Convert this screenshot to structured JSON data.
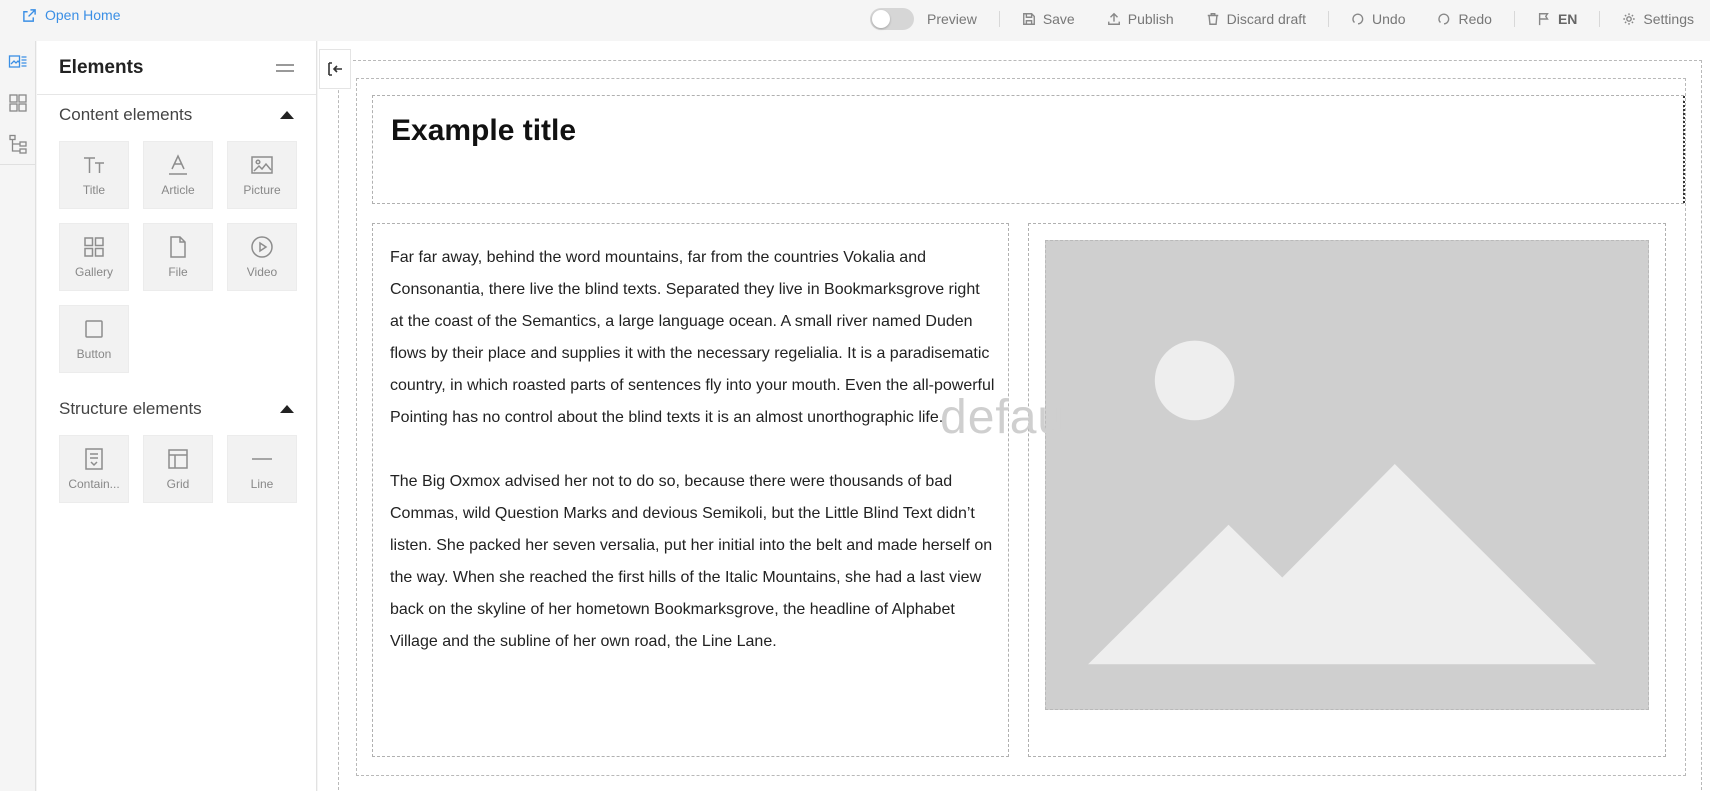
{
  "topbar": {
    "open_home": "Open Home",
    "preview": "Preview",
    "save": "Save",
    "publish": "Publish",
    "discard": "Discard draft",
    "undo": "Undo",
    "redo": "Redo",
    "lang": "EN",
    "settings": "Settings"
  },
  "panel": {
    "title": "Elements",
    "content_section": "Content elements",
    "structure_section": "Structure elements",
    "content_items": [
      "Title",
      "Article",
      "Picture",
      "Gallery",
      "File",
      "Video",
      "Button"
    ],
    "structure_items": [
      "Contain...",
      "Grid",
      "Line"
    ]
  },
  "canvas": {
    "title": "Example title",
    "paragraph1": "Far far away, behind the word mountains, far from the countries Vokalia and Consonantia, there live the blind texts. Separated they live in Bookmarksgrove right at the coast of the Semantics, a large language ocean. A small river named Duden flows by their place and supplies it with the necessary regelialia. It is a paradisematic country, in which roasted parts of sentences fly into your mouth. Even the all-powerful Pointing has no control about the blind texts it is an almost unorthographic life.",
    "paragraph2": "The Big Oxmox advised her not to do so, because there were thousands of bad Commas, wild Question Marks and devious Semikoli, but the Little Blind Text didn’t listen. She packed her seven versalia, put her initial into the belt and made herself on the way. When she reached the first hills of the Italic Mountains, she had a last view back on the skyline of her hometown Bookmarksgrove, the headline of Alphabet Village and the subline of her own road, the Line Lane.",
    "watermark": "defau"
  },
  "colors": {
    "accent": "#3b8fe5",
    "image_placeholder": "#cfcfcf"
  },
  "icons": {
    "rail": [
      "elements-panel-icon",
      "grid-layout-icon",
      "structure-tree-icon"
    ]
  }
}
